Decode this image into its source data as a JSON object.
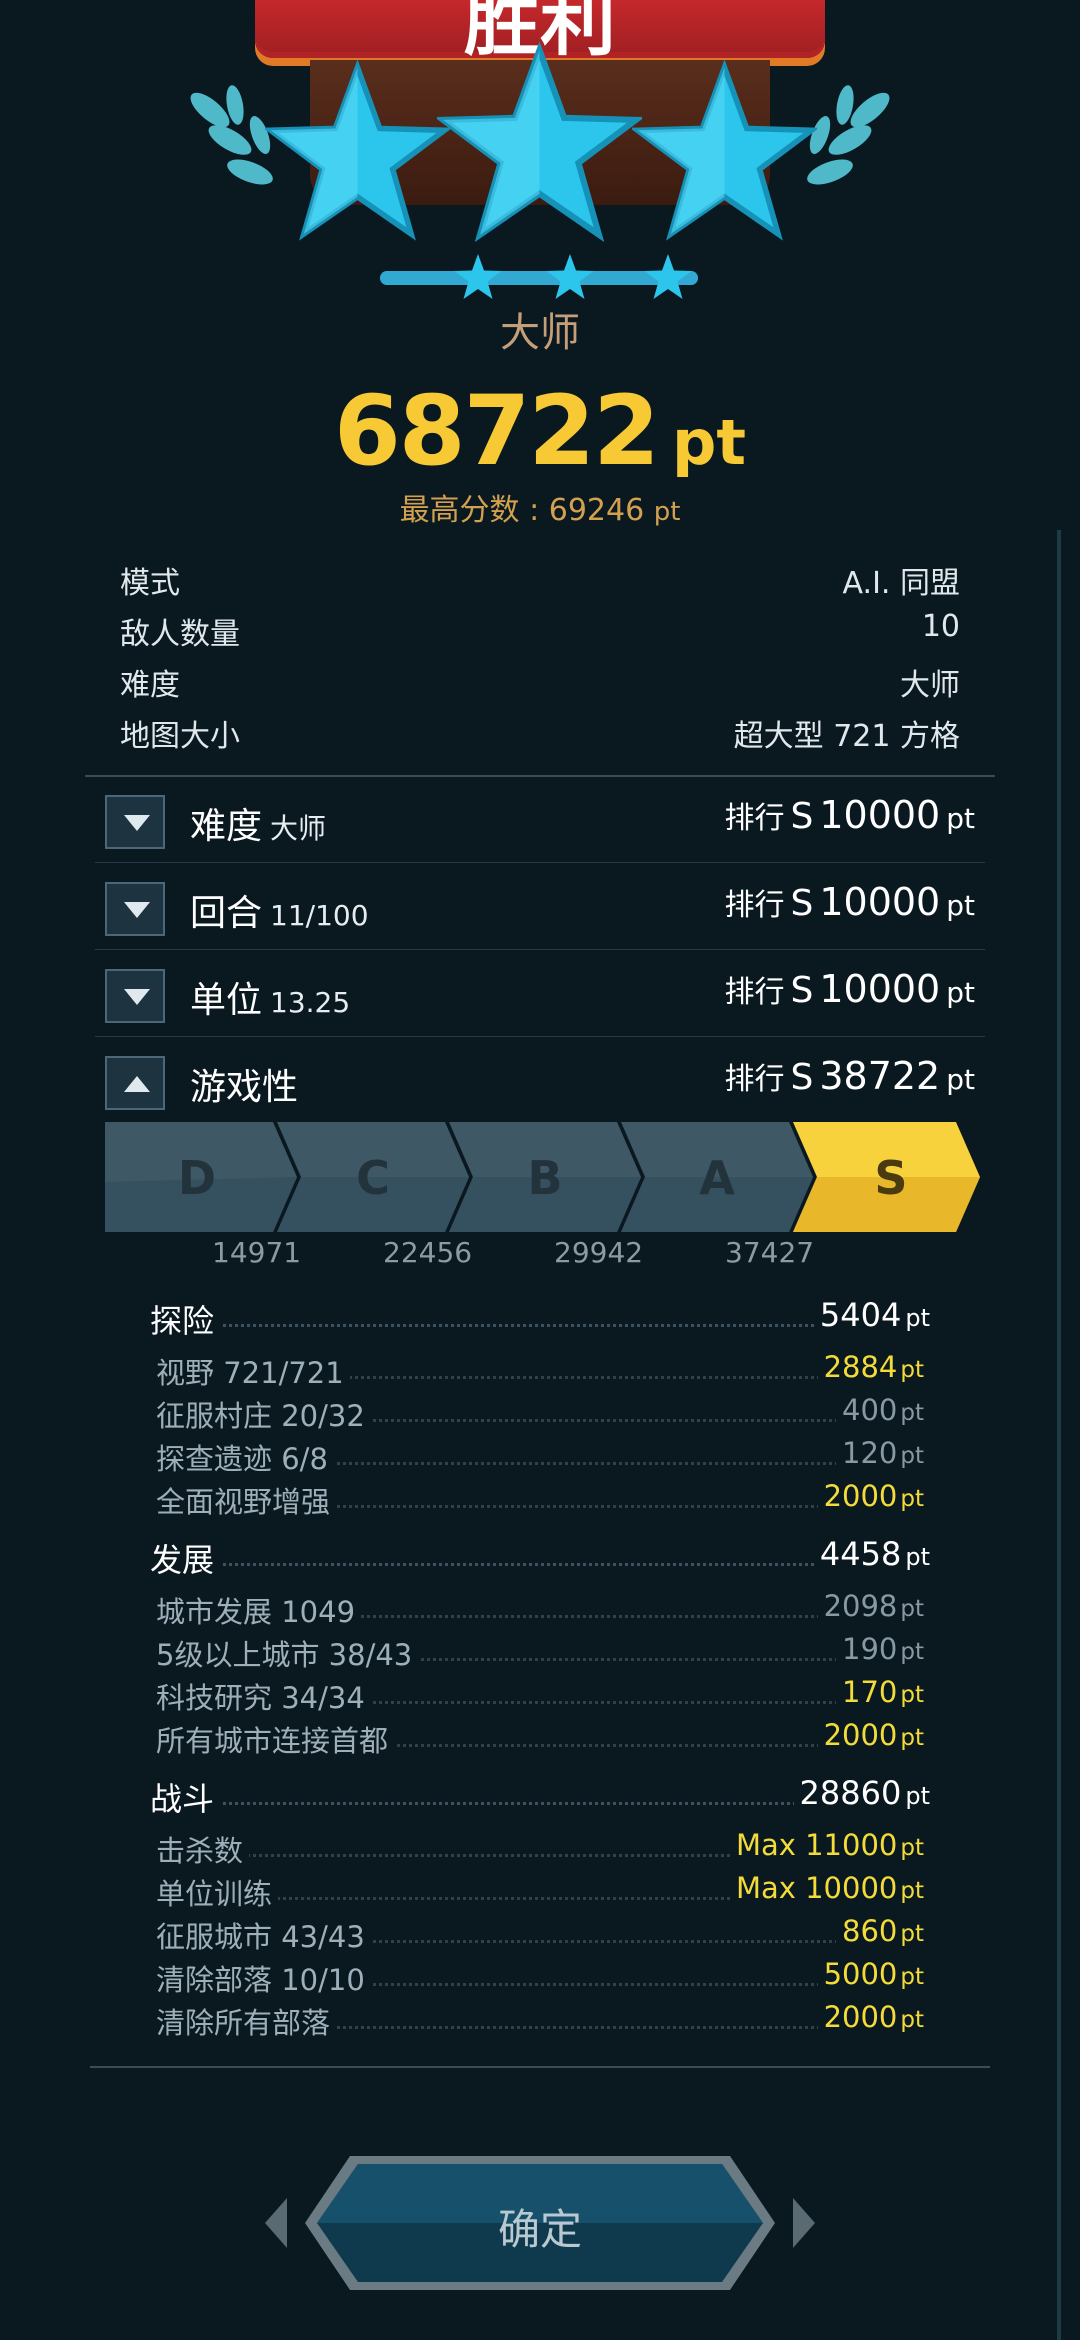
{
  "banner_title": "胜利",
  "rank_title": "大师",
  "score": {
    "value": "68722",
    "unit": "pt"
  },
  "best_score": {
    "label": "最高分数 : 69246",
    "unit": "pt"
  },
  "star_progress": 1.0,
  "match_info": [
    {
      "key": "模式",
      "value": "A.I. 同盟"
    },
    {
      "key": "敌人数量",
      "value": "10"
    },
    {
      "key": "难度",
      "value": "大师"
    },
    {
      "key": "地图大小",
      "value": "超大型 721 方格"
    }
  ],
  "categories": [
    {
      "name": "难度",
      "sub": "大师",
      "rank_label": "排行",
      "grade": "S",
      "points": "10000",
      "unit": "pt",
      "expanded": false
    },
    {
      "name": "回合",
      "sub": "11/100",
      "rank_label": "排行",
      "grade": "S",
      "points": "10000",
      "unit": "pt",
      "expanded": false
    },
    {
      "name": "单位",
      "sub": "13.25",
      "rank_label": "排行",
      "grade": "S",
      "points": "10000",
      "unit": "pt",
      "expanded": false
    },
    {
      "name": "游戏性",
      "sub": "",
      "rank_label": "排行",
      "grade": "S",
      "points": "38722",
      "unit": "pt",
      "expanded": true
    }
  ],
  "grade_scale": {
    "grades": [
      "D",
      "C",
      "B",
      "A",
      "S"
    ],
    "thresholds": [
      "14971",
      "22456",
      "29942",
      "37427"
    ],
    "active": "S"
  },
  "gameplay_sections": [
    {
      "name": "探险",
      "value": "5404",
      "unit": "pt",
      "items": [
        {
          "name": "视野 721/721",
          "value": "2884",
          "unit": "pt",
          "highlight": true
        },
        {
          "name": "征服村庄 20/32",
          "value": "400",
          "unit": "pt",
          "highlight": false
        },
        {
          "name": "探查遗迹 6/8",
          "value": "120",
          "unit": "pt",
          "highlight": false
        },
        {
          "name": "全面视野增强",
          "value": "2000",
          "unit": "pt",
          "highlight": true
        }
      ]
    },
    {
      "name": "发展",
      "value": "4458",
      "unit": "pt",
      "items": [
        {
          "name": "城市发展 1049",
          "value": "2098",
          "unit": "pt",
          "highlight": false
        },
        {
          "name": "5级以上城市 38/43",
          "value": "190",
          "unit": "pt",
          "highlight": false
        },
        {
          "name": "科技研究 34/34",
          "value": "170",
          "unit": "pt",
          "highlight": true
        },
        {
          "name": "所有城市连接首都",
          "value": "2000",
          "unit": "pt",
          "highlight": true
        }
      ]
    },
    {
      "name": "战斗",
      "value": "28860",
      "unit": "pt",
      "items": [
        {
          "name": "击杀数",
          "value": "Max 11000",
          "unit": "pt",
          "highlight": true
        },
        {
          "name": "单位训练",
          "value": "Max 10000",
          "unit": "pt",
          "highlight": true
        },
        {
          "name": "征服城市 43/43",
          "value": "860",
          "unit": "pt",
          "highlight": true
        },
        {
          "name": "清除部落 10/10",
          "value": "5000",
          "unit": "pt",
          "highlight": true
        },
        {
          "name": "清除所有部落",
          "value": "2000",
          "unit": "pt",
          "highlight": true
        }
      ]
    }
  ],
  "confirm_label": "确定",
  "colors": {
    "background": "#0a1820",
    "score_gold": "#f6c935",
    "highlight_yellow": "#f3dc3a",
    "star_blue": "#2cc6ec",
    "banner_red": "#c5282b",
    "grade_active": "#f7d23c"
  }
}
